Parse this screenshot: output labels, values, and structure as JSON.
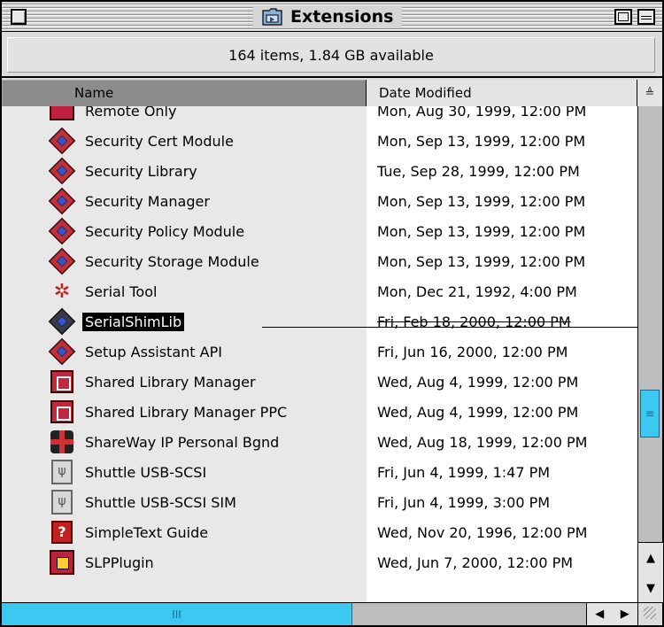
{
  "window": {
    "title": "Extensions",
    "status": "164 items, 1.84 GB available",
    "icons": {
      "title_folder": "folder-icon",
      "close": "close-box-icon",
      "zoom": "zoom-box-icon",
      "collapse": "collapse-box-icon"
    }
  },
  "columns": {
    "name": "Name",
    "date": "Date Modified",
    "sort_direction_glyph": "≜"
  },
  "rows": [
    {
      "name": "Remote Only",
      "date": "Mon, Aug 30, 1999, 12:00 PM",
      "icon": "remote-icon"
    },
    {
      "name": "Security Cert Module",
      "date": "Mon, Sep 13, 1999, 12:00 PM",
      "icon": "security-icon"
    },
    {
      "name": "Security Library",
      "date": "Tue, Sep 28, 1999, 12:00 PM",
      "icon": "security-icon"
    },
    {
      "name": "Security Manager",
      "date": "Mon, Sep 13, 1999, 12:00 PM",
      "icon": "security-icon"
    },
    {
      "name": "Security Policy Module",
      "date": "Mon, Sep 13, 1999, 12:00 PM",
      "icon": "security-icon"
    },
    {
      "name": "Security Storage Module",
      "date": "Mon, Sep 13, 1999, 12:00 PM",
      "icon": "security-icon"
    },
    {
      "name": "Serial Tool",
      "date": "Mon, Dec 21, 1992, 4:00 PM",
      "icon": "serial-tool-icon"
    },
    {
      "name": "SerialShimLib",
      "date": "Fri, Feb 18, 2000, 12:00 PM",
      "icon": "security-dark-icon",
      "selected": true
    },
    {
      "name": "Setup Assistant API",
      "date": "Fri, Jun 16, 2000, 12:00 PM",
      "icon": "security-icon"
    },
    {
      "name": "Shared Library Manager",
      "date": "Wed, Aug 4, 1999, 12:00 PM",
      "icon": "shared-library-icon"
    },
    {
      "name": "Shared Library Manager PPC",
      "date": "Wed, Aug 4, 1999, 12:00 PM",
      "icon": "shared-library-icon"
    },
    {
      "name": "ShareWay IP Personal Bgnd",
      "date": "Wed, Aug 18, 1999, 12:00 PM",
      "icon": "shareway-icon"
    },
    {
      "name": "Shuttle USB-SCSI",
      "date": "Fri, Jun 4, 1999, 1:47 PM",
      "icon": "usb-icon"
    },
    {
      "name": "Shuttle USB-SCSI SIM",
      "date": "Fri, Jun 4, 1999, 3:00 PM",
      "icon": "usb-icon"
    },
    {
      "name": "SimpleText Guide",
      "date": "Wed, Nov 20, 1996, 12:00 PM",
      "icon": "simpletext-guide-icon"
    },
    {
      "name": "SLPPlugin",
      "date": "Wed, Jun 7, 2000, 12:00 PM",
      "icon": "slp-plugin-icon"
    }
  ],
  "colors": {
    "scroll_thumb": "#3cc8f0",
    "sorted_column_header": "#8c8c8c",
    "selection": "#000000"
  },
  "scrollbar": {
    "vertical_thumb_glyph": "≡",
    "horizontal_thumb_glyph": "III",
    "up_arrow": "▲",
    "down_arrow": "▼",
    "left_arrow": "◀",
    "right_arrow": "▶"
  }
}
